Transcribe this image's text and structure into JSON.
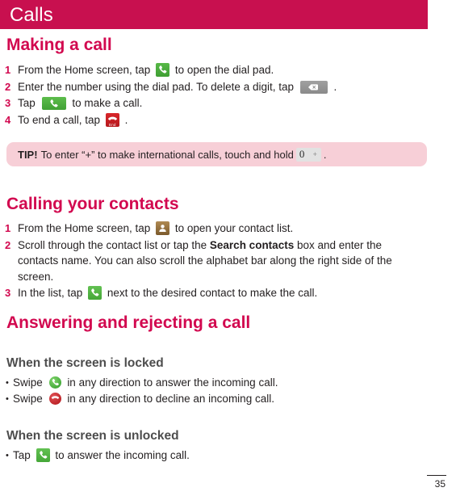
{
  "header": {
    "title": "Calls",
    "bar_color": "#c8104f"
  },
  "theme": {
    "accent": "#d2084f",
    "subheading": "#4d4d4d",
    "body_text": "#231f20",
    "tip_background": "#f7cfd7"
  },
  "sections": {
    "making_a_call": {
      "title": "Making a call",
      "steps": [
        {
          "number": "1",
          "before": "From the Home screen, tap",
          "icon": "dial-pad-icon",
          "after": "to open the dial pad."
        },
        {
          "number": "2",
          "before": "Enter the number using the dial pad. To delete a digit, tap",
          "icon": "delete-key-icon",
          "after": "."
        },
        {
          "number": "3",
          "before": "Tap",
          "icon": "call-button-icon",
          "after": "to make a call."
        },
        {
          "number": "4",
          "before": "To end a call, tap",
          "icon": "end-call-icon",
          "icon_label": "End",
          "after": "."
        }
      ]
    },
    "tip": {
      "label": "TIP!",
      "before": "To enter “+” to make international calls, touch and hold",
      "icon": "zero-plus-key-icon",
      "key_digit": "0",
      "key_symbol": "+",
      "after": "."
    },
    "calling_your_contacts": {
      "title": "Calling your contacts",
      "steps": [
        {
          "number": "1",
          "before": "From the Home screen, tap",
          "icon": "contacts-icon",
          "after": "to open your contact list."
        },
        {
          "number": "2",
          "before": "Scroll through the contact list or tap the",
          "bold": "Search contacts",
          "after": "box and enter the contacts name. You can also scroll the alphabet bar along the right side of the screen."
        },
        {
          "number": "3",
          "before": "In the list, tap",
          "icon": "contact-call-icon",
          "after": "next to the desired contact to make the call."
        }
      ]
    },
    "answering_and_rejecting": {
      "title": "Answering and rejecting a call",
      "when_locked": {
        "title": "When the screen is locked",
        "bullets": [
          {
            "marker": "•",
            "before": "Swipe",
            "icon": "answer-call-circle-icon",
            "after": "in any direction to answer the incoming call."
          },
          {
            "marker": "•",
            "before": "Swipe",
            "icon": "decline-call-circle-icon",
            "after": "in any direction to decline an incoming call."
          }
        ]
      },
      "when_unlocked": {
        "title": "When the screen is unlocked",
        "bullets": [
          {
            "marker": "•",
            "before": "Tap",
            "icon": "answer-call-square-icon",
            "after": "to answer the incoming call."
          }
        ]
      }
    }
  },
  "footer": {
    "page_number": "35"
  }
}
